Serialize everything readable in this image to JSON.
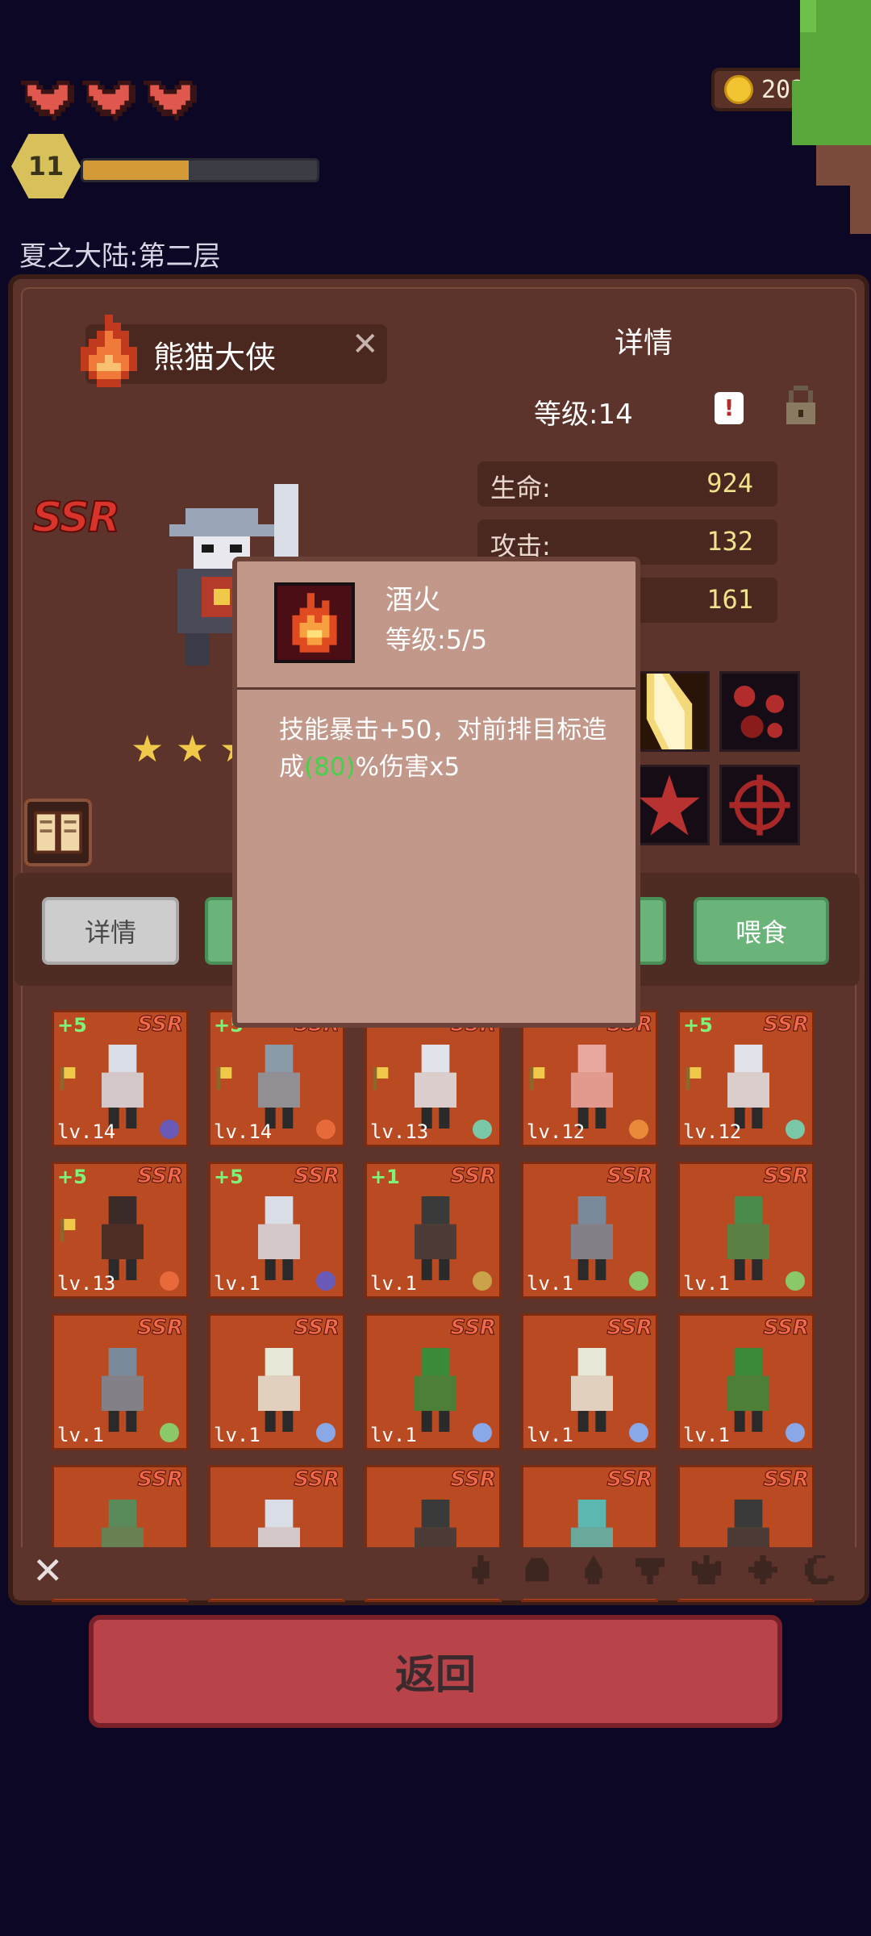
{
  "hud": {
    "hearts": 3,
    "player_level": "11",
    "xp_progress_percent": 45,
    "zone_title": "夏之大陆:第二层",
    "coins": "202.0K"
  },
  "hero": {
    "name": "熊猫大侠",
    "rarity": "SSR",
    "detail_title": "详情",
    "level_label": "等级:14",
    "stars": 3,
    "stats": [
      {
        "label": "生命:",
        "value": "924"
      },
      {
        "label": "攻击:",
        "value": "132"
      },
      {
        "label": "",
        "value": "161"
      }
    ]
  },
  "tabs": {
    "detail": "详情",
    "feed": "喂食"
  },
  "popup": {
    "skill_name": "酒火",
    "skill_level": "等级:5/5",
    "desc_part1": "技能暴击+50，对前排目标造成",
    "desc_highlight": "(80)",
    "desc_part2": "%伤害x5"
  },
  "roster": [
    {
      "plus": "+5",
      "rarity": "SSR",
      "level": "lv.14",
      "element": "moon"
    },
    {
      "plus": "+5",
      "rarity": "SSR",
      "level": "lv.14",
      "element": "fire"
    },
    {
      "plus": "",
      "rarity": "SSR",
      "level": "lv.13",
      "element": "wind"
    },
    {
      "plus": "",
      "rarity": "SSR",
      "level": "lv.12",
      "element": "sun"
    },
    {
      "plus": "+5",
      "rarity": "SSR",
      "level": "lv.12",
      "element": "wind"
    },
    {
      "plus": "+5",
      "rarity": "SSR",
      "level": "lv.13",
      "element": "fire"
    },
    {
      "plus": "+5",
      "rarity": "SSR",
      "level": "lv.1",
      "element": "moon"
    },
    {
      "plus": "+1",
      "rarity": "SSR",
      "level": "lv.1",
      "element": "earth"
    },
    {
      "plus": "",
      "rarity": "SSR",
      "level": "lv.1",
      "element": "leaf"
    },
    {
      "plus": "",
      "rarity": "SSR",
      "level": "lv.1",
      "element": "leaf"
    },
    {
      "plus": "",
      "rarity": "SSR",
      "level": "lv.1",
      "element": "leaf"
    },
    {
      "plus": "",
      "rarity": "SSR",
      "level": "lv.1",
      "element": "water"
    },
    {
      "plus": "",
      "rarity": "SSR",
      "level": "lv.1",
      "element": "water"
    },
    {
      "plus": "",
      "rarity": "SSR",
      "level": "lv.1",
      "element": "water"
    },
    {
      "plus": "",
      "rarity": "SSR",
      "level": "lv.1",
      "element": "water"
    },
    {
      "plus": "",
      "rarity": "SSR",
      "level": "",
      "element": ""
    },
    {
      "plus": "",
      "rarity": "SSR",
      "level": "",
      "element": ""
    },
    {
      "plus": "",
      "rarity": "SSR",
      "level": "",
      "element": ""
    },
    {
      "plus": "",
      "rarity": "SSR",
      "level": "",
      "element": ""
    },
    {
      "plus": "",
      "rarity": "SSR",
      "level": "",
      "element": ""
    }
  ],
  "return_button": "返回"
}
